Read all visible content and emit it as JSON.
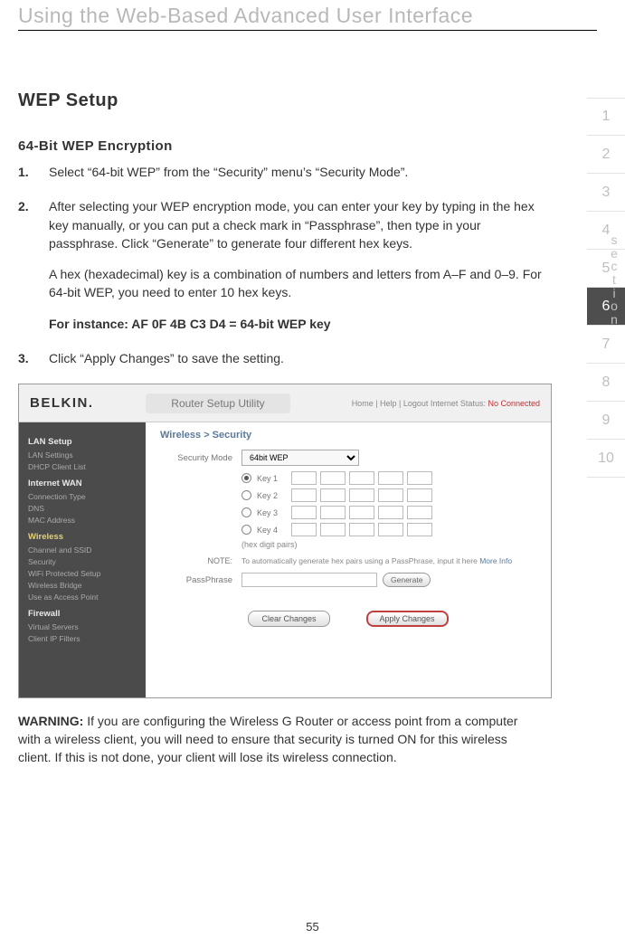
{
  "page": {
    "header": "Using the Web-Based Advanced User Interface",
    "section_label": "section",
    "page_number": "55"
  },
  "tabs": {
    "items": [
      "1",
      "2",
      "3",
      "4",
      "5",
      "6",
      "7",
      "8",
      "9",
      "10"
    ],
    "active_index": 5
  },
  "content": {
    "h1": "WEP Setup",
    "h2": "64-Bit WEP Encryption",
    "steps": [
      {
        "num": "1.",
        "paras": [
          "Select “64-bit WEP” from the “Security” menu’s “Security Mode”."
        ]
      },
      {
        "num": "2.",
        "paras": [
          "After selecting your WEP encryption mode, you can enter your key by typing in the hex key manually, or you can put a check mark in “Passphrase”, then type in your passphrase. Click “Generate” to generate four different hex keys.",
          "A hex (hexadecimal) key is a combination of numbers and letters from A–F and 0–9. For 64-bit WEP, you need to enter 10 hex keys."
        ],
        "bold": "For instance:  AF 0F 4B C3 D4 = 64-bit WEP key"
      },
      {
        "num": "3.",
        "paras": [
          "Click “Apply Changes” to save the setting."
        ]
      }
    ],
    "warning_label": "WARNING:",
    "warning_text": " If you are configuring the Wireless G Router or access point from a computer with a wireless client, you will need to ensure that security is turned ON for this wireless client. If this is not done, your client will lose its wireless connection."
  },
  "screenshot": {
    "logo": "BELKIN.",
    "title": "Router Setup Utility",
    "toplinks_prefix": "Home | Help | Logout   Internet Status: ",
    "toplinks_status": "No Connected",
    "breadcrumb": "Wireless > Security",
    "sidebar": {
      "sections": [
        {
          "title": "LAN Setup",
          "items": [
            "LAN Settings",
            "DHCP Client List"
          ]
        },
        {
          "title": "Internet WAN",
          "items": [
            "Connection Type",
            "DNS",
            "MAC Address"
          ]
        },
        {
          "title": "Wireless",
          "hl": true,
          "items": [
            "Channel and SSID",
            "Security",
            "WiFi Protected Setup",
            "Wireless Bridge",
            "Use as Access Point"
          ]
        },
        {
          "title": "Firewall",
          "items": [
            "Virtual Servers",
            "Client IP Filters"
          ]
        }
      ]
    },
    "security_mode_label": "Security Mode",
    "security_mode_value": "64bit WEP",
    "keys": [
      "Key 1",
      "Key 2",
      "Key 3",
      "Key 4"
    ],
    "hex_note": "(hex digit pairs)",
    "note_label": "NOTE:",
    "note_text": "To automatically generate hex pairs using a PassPhrase, input it here ",
    "note_more": "More Info",
    "passphrase_label": "PassPhrase",
    "generate_btn": "Generate",
    "clear_btn": "Clear Changes",
    "apply_btn": "Apply Changes"
  }
}
